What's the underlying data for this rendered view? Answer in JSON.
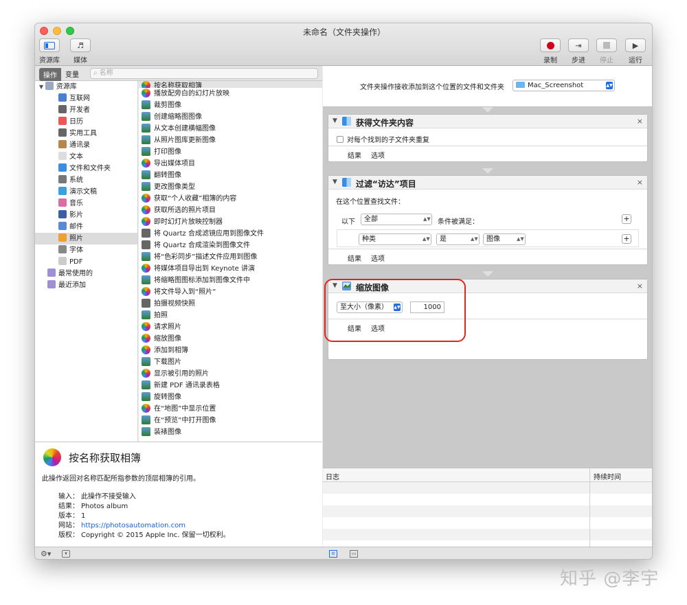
{
  "window": {
    "title": "未命名（文件夹操作）"
  },
  "toolbar": {
    "library_label": "资源库",
    "media_label": "媒体",
    "record_label": "录制",
    "step_label": "步进",
    "stop_label": "停止",
    "run_label": "运行"
  },
  "tabs": {
    "actions": "操作",
    "variables": "变量",
    "search_placeholder": "名称"
  },
  "library": {
    "items": [
      {
        "label": "资源库",
        "icon": "folder-icon"
      },
      {
        "label": "互联网",
        "icon": "globe-icon"
      },
      {
        "label": "开发者",
        "icon": "tools-icon"
      },
      {
        "label": "日历",
        "icon": "calendar-icon"
      },
      {
        "label": "实用工具",
        "icon": "tools-icon"
      },
      {
        "label": "通讯录",
        "icon": "contacts-icon"
      },
      {
        "label": "文本",
        "icon": "text-icon"
      },
      {
        "label": "文件和文件夹",
        "icon": "finder-icon"
      },
      {
        "label": "系统",
        "icon": "system-icon"
      },
      {
        "label": "演示文稿",
        "icon": "presentation-icon"
      },
      {
        "label": "音乐",
        "icon": "music-icon"
      },
      {
        "label": "影片",
        "icon": "movie-icon"
      },
      {
        "label": "邮件",
        "icon": "mail-icon"
      },
      {
        "label": "照片",
        "icon": "photos-icon"
      },
      {
        "label": "字体",
        "icon": "font-icon"
      },
      {
        "label": "PDF",
        "icon": "pdf-icon"
      }
    ],
    "smart": [
      {
        "label": "最常使用的"
      },
      {
        "label": "最近添加"
      }
    ]
  },
  "actions": {
    "items": [
      "按名称获取相簿",
      "播放配旁白的幻灯片放映",
      "裁剪图像",
      "创建缩略图图像",
      "从文本创建横幅图像",
      "从照片图库更新图像",
      "打印图像",
      "导出媒体项目",
      "翻转图像",
      "更改图像类型",
      "获取“个人收藏”相簿的内容",
      "获取所选的照片项目",
      "即时幻灯片放映控制器",
      "将 Quartz 合成滤镜应用到图像文件",
      "将 Quartz 合成渲染到图像文件",
      "将“色彩同步”描述文件应用到图像",
      "将媒体项目导出到 Keynote 讲演",
      "将缩略图图标添加到图像文件中",
      "将文件导入到“照片”",
      "拍摄视频快照",
      "拍照",
      "请求照片",
      "缩放图像",
      "添加到相簿",
      "下载图片",
      "显示被引用的照片",
      "新建 PDF 通讯录表格",
      "旋转图像",
      "在“地图”中显示位置",
      "在“预览”中打开图像",
      "装裱图像"
    ]
  },
  "description": {
    "title": "按名称获取相簿",
    "summary": "此操作返回对名称匹配所指参数的顶层相簿的引用。",
    "input_key": "输入：",
    "input_val": "此操作不接受输入",
    "result_key": "结果：",
    "result_val": "Photos album",
    "version_key": "版本：",
    "version_val": "1",
    "website_key": "网站：",
    "website_val": "https://photosautomation.com",
    "copyright_key": "版权：",
    "copyright_val": "Copyright © 2015 Apple Inc. 保留一切权利。"
  },
  "workflow": {
    "header_label": "文件夹操作接收添加到这个位置的文件和文件夹",
    "folder": "Mac_Screenshot",
    "cards": {
      "get_folder": {
        "title": "获得文件夹内容",
        "checkbox": "对每个找到的子文件夹重复",
        "results": "结果",
        "options": "选项"
      },
      "filter": {
        "title": "过滤“访达”项目",
        "find_label": "在这个位置查找文件：",
        "prefix": "以下",
        "scope": "全部",
        "condition": "条件被满足：",
        "field": "种类",
        "op": "是",
        "value": "图像",
        "results": "结果",
        "options": "选项"
      },
      "scale": {
        "title": "缩放图像",
        "mode": "至大小（像素）",
        "size": "1000",
        "results": "结果",
        "options": "选项"
      }
    }
  },
  "log": {
    "col_log": "日志",
    "col_duration": "持续时间"
  },
  "watermark": "知乎 @李宇",
  "colors": {
    "highlight": "#e2231a",
    "accent": "#1e6ee6"
  }
}
